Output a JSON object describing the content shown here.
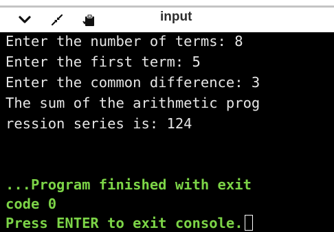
{
  "toolbar": {
    "title": "input",
    "icons": [
      "chevron-down-icon",
      "collapse-arrows-icon",
      "paste-clipboard-icon"
    ]
  },
  "console": {
    "output_lines": [
      "Enter the number of terms: 8",
      "Enter the first term: 5",
      "Enter the common difference: 3",
      "The sum of the arithmetic prog",
      "ression series is: 124"
    ],
    "finish_lines": [
      "...Program finished with exit",
      "code 0",
      "Press ENTER to exit console."
    ]
  },
  "colors": {
    "console_background": "#000000",
    "output_text": "#e6e6e6",
    "finish_text": "#7cd447",
    "toolbar_background": "#ffffff"
  }
}
